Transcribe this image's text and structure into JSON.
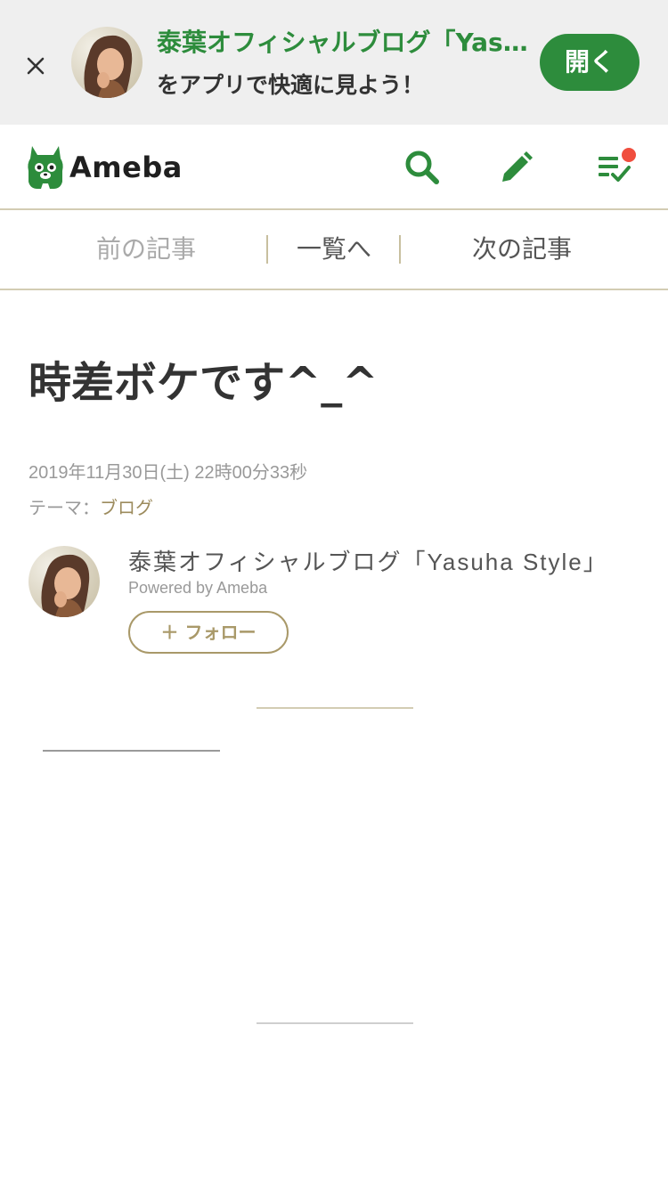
{
  "banner": {
    "title": "泰葉オフィシャルブログ「Yasuha Style」",
    "subtitle": "をアプリで快適に見よう！",
    "open_label": "開く"
  },
  "header": {
    "logo_text": "Ameba",
    "icons": [
      "search-icon",
      "pencil-icon",
      "reader-list-icon"
    ],
    "notification_color": "#f04e3e",
    "brand_color": "#2d8c3c"
  },
  "pager": {
    "prev": "前の記事",
    "list": "一覧へ",
    "next": "次の記事"
  },
  "article": {
    "title": "時差ボケです^_^",
    "date": "2019年11月30日(土) 22時00分33秒",
    "theme_label": "テーマ：",
    "theme_value": "ブログ"
  },
  "author": {
    "blog_name": "泰葉オフィシャルブログ「Yasuha Style」",
    "powered": "Powered by Ameba",
    "follow_label": "＋ フォロー"
  }
}
